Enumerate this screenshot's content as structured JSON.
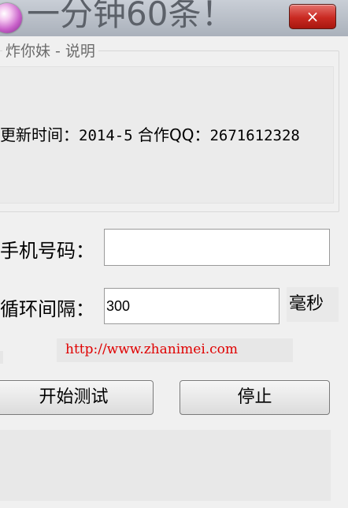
{
  "window": {
    "title": "一分钟60条！",
    "close_label": "×"
  },
  "about": {
    "group_title": "炸你妹 - 说明",
    "update_label": "更新时间：",
    "update_value": "2014-5",
    "qq_label": " 合作QQ：",
    "qq_value": "2671612328"
  },
  "form": {
    "phone_label": "手机号码：",
    "phone_value": "",
    "interval_label": "循环间隔：",
    "interval_value": "300",
    "interval_unit": "毫秒"
  },
  "link": {
    "url": "http://www.zhanimei.com"
  },
  "buttons": {
    "start_label": "开始测试",
    "stop_label": "停止"
  }
}
